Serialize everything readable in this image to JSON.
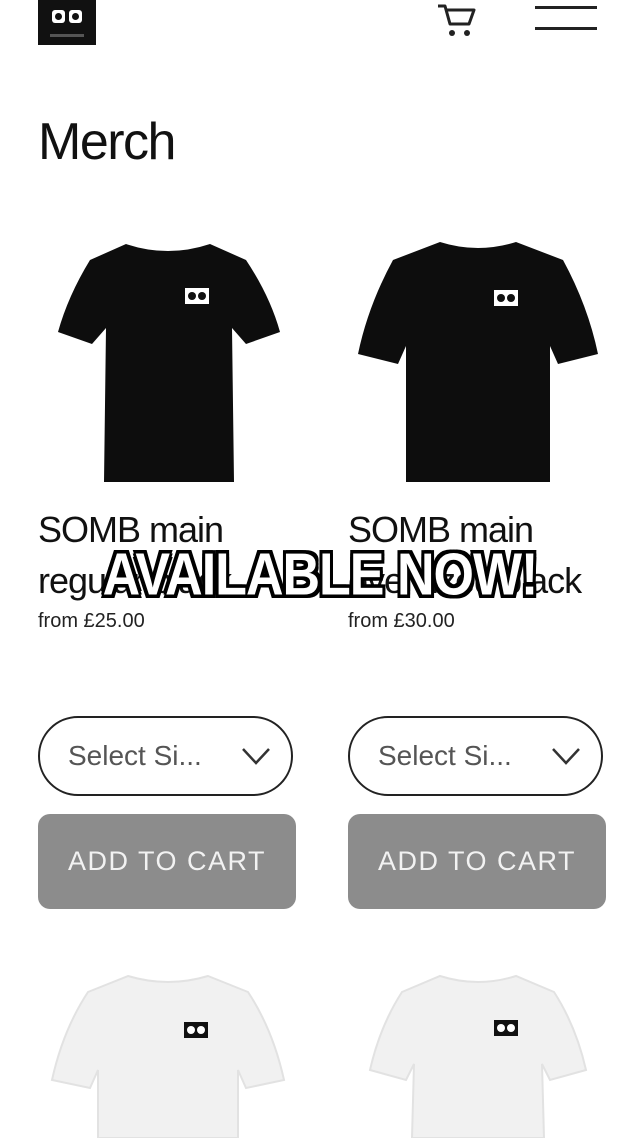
{
  "header": {
    "logo_icon": "cassette-logo-icon",
    "cart_icon": "cart-icon",
    "menu_icon": "hamburger-menu-icon"
  },
  "page": {
    "title": "Merch"
  },
  "products": [
    {
      "name": "SOMB main regular black",
      "price": "from £25.00",
      "size_select": "Select Si...",
      "add_to_cart": "ADD TO CART",
      "color": "#111111"
    },
    {
      "name": "SOMB main oversized black",
      "price": "from £30.00",
      "size_select": "Select Si...",
      "add_to_cart": "ADD TO CART",
      "color": "#111111"
    }
  ],
  "overlay": {
    "text": "AVAILABLE NOW!"
  },
  "colors": {
    "button_bg": "#8c8c8c",
    "accent": "#111111",
    "background": "#ffffff"
  }
}
